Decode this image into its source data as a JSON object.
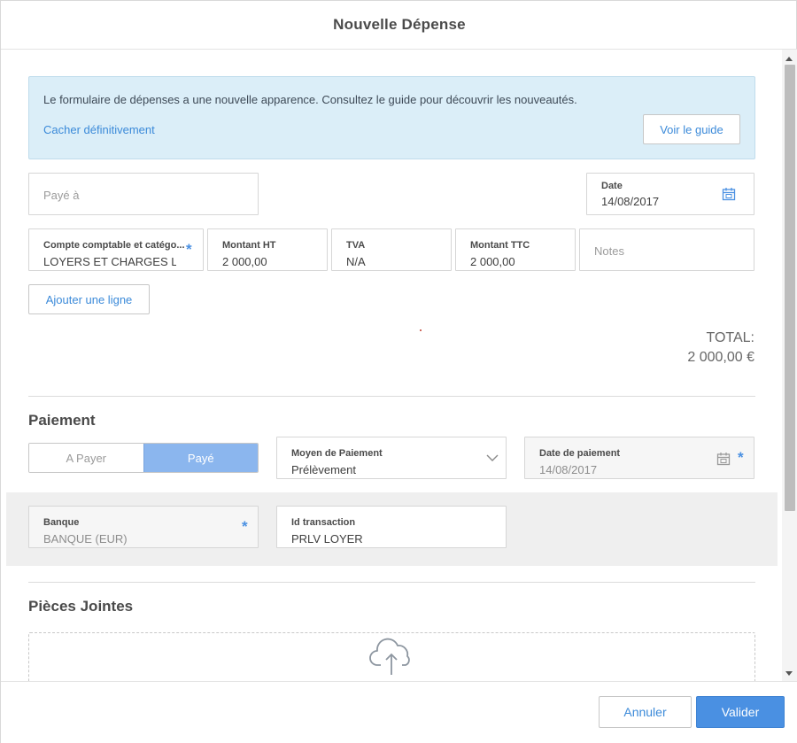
{
  "dialog": {
    "title": "Nouvelle Dépense"
  },
  "banner": {
    "text": "Le formulaire de dépenses a une nouvelle apparence. Consultez le guide pour découvrir les nouveautés.",
    "hide_link": "Cacher définitivement",
    "guide_button": "Voir le guide"
  },
  "payee": {
    "placeholder": "Payé à"
  },
  "date": {
    "label": "Date",
    "value": "14/08/2017",
    "icon": "calendar-icon"
  },
  "line": {
    "account": {
      "label": "Compte comptable et catégo...",
      "value": "LOYERS ET CHARGES LOC",
      "required": "*"
    },
    "amount_ht": {
      "label": "Montant HT",
      "value": "2 000,00"
    },
    "tva": {
      "label": "TVA",
      "value": "N/A"
    },
    "amount_ttc": {
      "label": "Montant TTC",
      "value": "2 000,00"
    },
    "notes": {
      "placeholder": "Notes"
    }
  },
  "add_line_button": "Ajouter une ligne",
  "total": {
    "label": "TOTAL:",
    "value": "2 000,00 €"
  },
  "payment": {
    "title": "Paiement",
    "toggle": {
      "unpaid": "A Payer",
      "paid": "Payé",
      "selected": "Payé"
    },
    "method": {
      "label": "Moyen de Paiement",
      "value": "Prélèvement"
    },
    "date": {
      "label": "Date de paiement",
      "value": "14/08/2017",
      "required": "*"
    },
    "bank": {
      "label": "Banque",
      "value": "BANQUE  (EUR)",
      "required": "*"
    },
    "transaction": {
      "label": "Id transaction",
      "value": "PRLV LOYER"
    }
  },
  "attachments": {
    "title": "Pièces Jointes",
    "icon": "cloud-upload-icon"
  },
  "footer": {
    "cancel": "Annuler",
    "submit": "Valider"
  },
  "colors": {
    "accent": "#4a90e2",
    "banner_bg": "#dbeef8",
    "toggle_active": "#8bb6ee"
  }
}
